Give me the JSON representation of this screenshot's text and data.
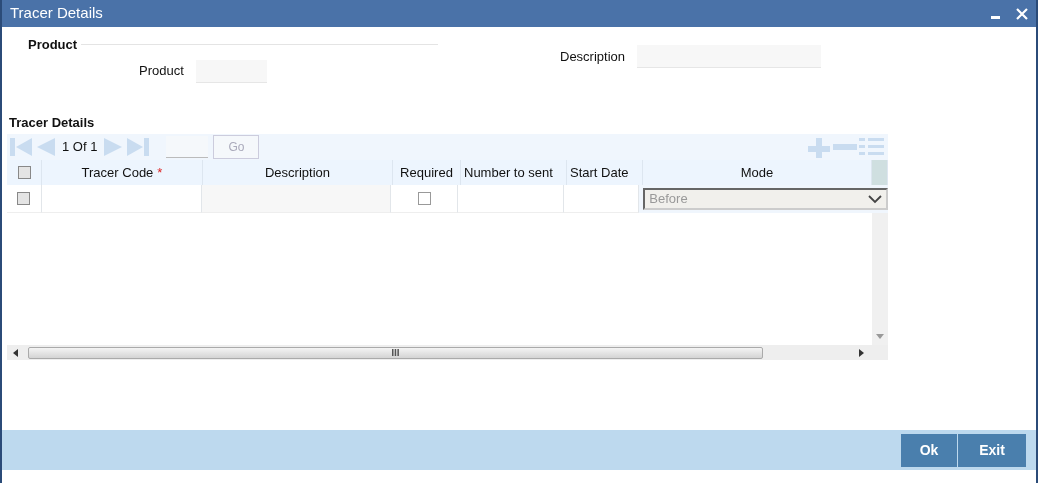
{
  "window": {
    "title": "Tracer Details"
  },
  "product_section": {
    "legend": "Product",
    "product_label": "Product",
    "description_label": "Description"
  },
  "tracer_details": {
    "title": "Tracer Details",
    "pager": {
      "page": "1 Of 1",
      "go": "Go",
      "go_disabled": true
    },
    "columns": [
      {
        "label": "Tracer Code",
        "mandatory_mark": "*"
      },
      {
        "label": "Description"
      },
      {
        "label": "Required"
      },
      {
        "label": "Number to sent"
      },
      {
        "label": "Start Date"
      },
      {
        "label": "Mode"
      }
    ],
    "select_all": false,
    "rows": [
      {
        "selected": false,
        "required": false,
        "mode": "Before"
      }
    ]
  },
  "buttons": [
    "Ok",
    "Exit"
  ]
}
